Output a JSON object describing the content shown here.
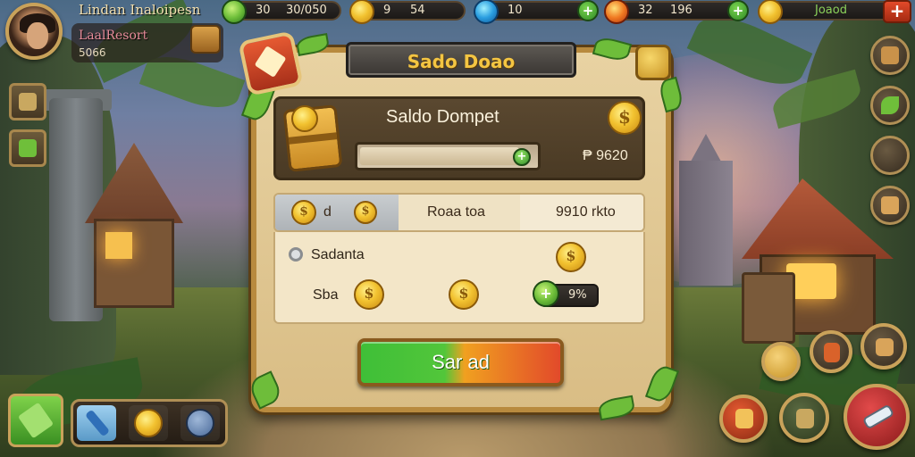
{
  "player": {
    "name": "Lindan Inaloipesn",
    "resort": "LaalResort",
    "resort_sub": "5066",
    "avatar_icon": "player-portrait"
  },
  "currencies": [
    {
      "icon": "leaf-icon",
      "value": "30",
      "value2": "30/050",
      "color": "#6fbf3a"
    },
    {
      "icon": "coin-icon",
      "value": "9",
      "value2": "54",
      "color": "#f2c230"
    },
    {
      "icon": "gem-icon",
      "value": "10",
      "value2": "",
      "color": "#2a9ee0"
    },
    {
      "icon": "fire-icon",
      "value": "32",
      "value2": "196",
      "color": "#f07a22"
    },
    {
      "icon": "coin-icon",
      "value": "Joaod",
      "value2": "",
      "color": "#f2c230"
    }
  ],
  "dialog": {
    "title": "Sado Doao",
    "wallet_title": "Saldo Dompet",
    "balance": "₱ 9620",
    "progress": 0.88,
    "tabs": [
      {
        "label": "d"
      },
      {
        "label": "Roaa toa"
      },
      {
        "label": "9910 rkto"
      }
    ],
    "row1_label": "Sadanta",
    "row2_label": "Sba",
    "percent": "9%",
    "save_label": "Sar ad"
  },
  "colors": {
    "frame": "#b88a3e",
    "parchment": "#e8d2a2",
    "title_gold": "#f4c542",
    "green": "#3fbf38",
    "red": "#e24a2a"
  }
}
